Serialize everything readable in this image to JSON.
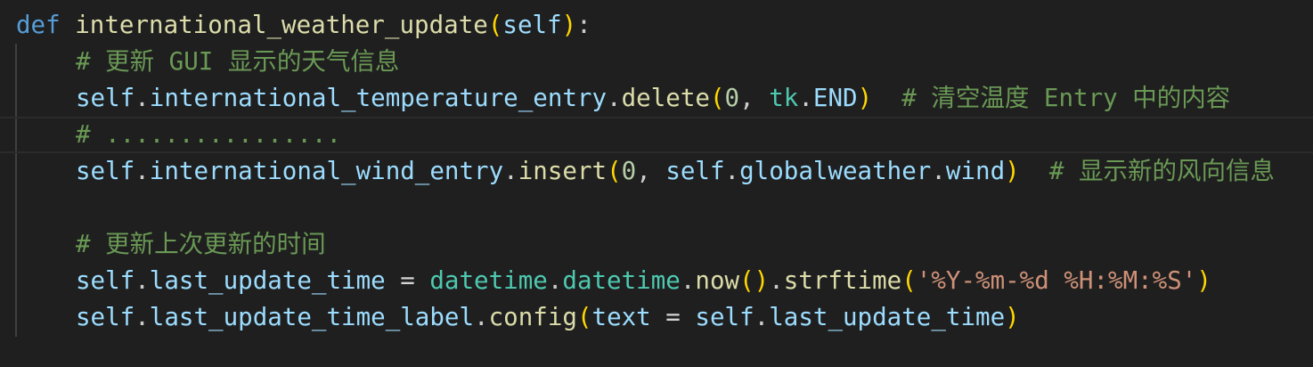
{
  "editor": {
    "colors": {
      "background": "#1f1f1f",
      "keyword": "#569cd6",
      "function": "#dcdcaa",
      "variable": "#9cdcfe",
      "class": "#4ec9b0",
      "number": "#b5cea8",
      "string": "#ce9178",
      "comment": "#6a9955",
      "bracket": "#ffd700"
    },
    "lines": [
      {
        "tokens": [
          {
            "t": "def",
            "c": "kw"
          },
          {
            "t": " ",
            "c": "punc"
          },
          {
            "t": "international_weather_update",
            "c": "fn"
          },
          {
            "t": "(",
            "c": "br1"
          },
          {
            "t": "self",
            "c": "var"
          },
          {
            "t": ")",
            "c": "br1"
          },
          {
            "t": ":",
            "c": "punc"
          }
        ]
      },
      {
        "tokens": [
          {
            "t": "# 更新 GUI 显示的天气信息",
            "c": "com"
          }
        ]
      },
      {
        "tokens": [
          {
            "t": "self",
            "c": "var"
          },
          {
            "t": ".",
            "c": "punc"
          },
          {
            "t": "international_temperature_entry",
            "c": "var"
          },
          {
            "t": ".",
            "c": "punc"
          },
          {
            "t": "delete",
            "c": "fn"
          },
          {
            "t": "(",
            "c": "br1"
          },
          {
            "t": "0",
            "c": "num"
          },
          {
            "t": ", ",
            "c": "punc"
          },
          {
            "t": "tk",
            "c": "cls"
          },
          {
            "t": ".",
            "c": "punc"
          },
          {
            "t": "END",
            "c": "var"
          },
          {
            "t": ")",
            "c": "br1"
          },
          {
            "t": "  ",
            "c": "punc"
          },
          {
            "t": "# 清空温度 Entry 中的内容",
            "c": "com"
          }
        ]
      },
      {
        "tokens": [
          {
            "t": "# ................",
            "c": "com"
          }
        ]
      },
      {
        "tokens": [
          {
            "t": "self",
            "c": "var"
          },
          {
            "t": ".",
            "c": "punc"
          },
          {
            "t": "international_wind_entry",
            "c": "var"
          },
          {
            "t": ".",
            "c": "punc"
          },
          {
            "t": "insert",
            "c": "fn"
          },
          {
            "t": "(",
            "c": "br1"
          },
          {
            "t": "0",
            "c": "num"
          },
          {
            "t": ", ",
            "c": "punc"
          },
          {
            "t": "self",
            "c": "var"
          },
          {
            "t": ".",
            "c": "punc"
          },
          {
            "t": "globalweather",
            "c": "var"
          },
          {
            "t": ".",
            "c": "punc"
          },
          {
            "t": "wind",
            "c": "var"
          },
          {
            "t": ")",
            "c": "br1"
          },
          {
            "t": "  ",
            "c": "punc"
          },
          {
            "t": "# 显示新的风向信息",
            "c": "com"
          }
        ]
      },
      {
        "tokens": []
      },
      {
        "tokens": [
          {
            "t": "# 更新上次更新的时间",
            "c": "com"
          }
        ]
      },
      {
        "tokens": [
          {
            "t": "self",
            "c": "var"
          },
          {
            "t": ".",
            "c": "punc"
          },
          {
            "t": "last_update_time",
            "c": "var"
          },
          {
            "t": " = ",
            "c": "op"
          },
          {
            "t": "datetime",
            "c": "cls"
          },
          {
            "t": ".",
            "c": "punc"
          },
          {
            "t": "datetime",
            "c": "cls"
          },
          {
            "t": ".",
            "c": "punc"
          },
          {
            "t": "now",
            "c": "fn"
          },
          {
            "t": "()",
            "c": "br1"
          },
          {
            "t": ".",
            "c": "punc"
          },
          {
            "t": "strftime",
            "c": "fn"
          },
          {
            "t": "(",
            "c": "br1"
          },
          {
            "t": "'%Y-%m-%d %H:%M:%S'",
            "c": "str"
          },
          {
            "t": ")",
            "c": "br1"
          }
        ]
      },
      {
        "tokens": [
          {
            "t": "self",
            "c": "var"
          },
          {
            "t": ".",
            "c": "punc"
          },
          {
            "t": "last_update_time_label",
            "c": "var"
          },
          {
            "t": ".",
            "c": "punc"
          },
          {
            "t": "config",
            "c": "fn"
          },
          {
            "t": "(",
            "c": "br1"
          },
          {
            "t": "text",
            "c": "var"
          },
          {
            "t": " = ",
            "c": "op"
          },
          {
            "t": "self",
            "c": "var"
          },
          {
            "t": ".",
            "c": "punc"
          },
          {
            "t": "last_update_time",
            "c": "var"
          },
          {
            "t": ")",
            "c": "br1"
          }
        ]
      }
    ]
  }
}
